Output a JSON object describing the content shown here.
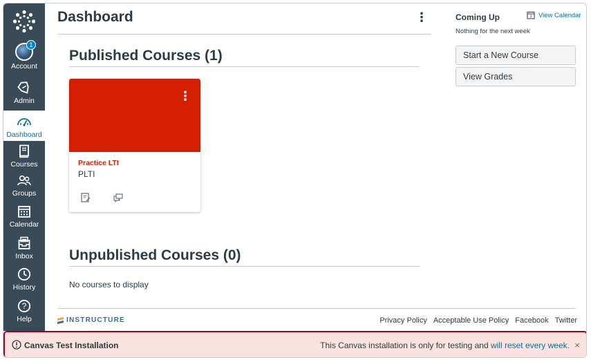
{
  "sidebar": {
    "logo_icon": "canvas-logo-icon",
    "items": [
      {
        "label": "Account",
        "icon": "avatar",
        "badge": "1"
      },
      {
        "label": "Admin",
        "icon": "shield-icon"
      },
      {
        "label": "Dashboard",
        "icon": "dashboard-gauge-icon",
        "active": true
      },
      {
        "label": "Courses",
        "icon": "book-icon"
      },
      {
        "label": "Groups",
        "icon": "groups-icon"
      },
      {
        "label": "Calendar",
        "icon": "calendar-icon"
      },
      {
        "label": "Inbox",
        "icon": "inbox-icon"
      },
      {
        "label": "History",
        "icon": "clock-icon"
      },
      {
        "label": "Help",
        "icon": "help-icon"
      }
    ]
  },
  "header": {
    "title": "Dashboard",
    "options_icon": "kebab-icon"
  },
  "published": {
    "heading": "Published Courses (1)",
    "courses": [
      {
        "name": "Practice LTI",
        "code": "PLTI",
        "color": "#d41e00"
      }
    ]
  },
  "unpublished": {
    "heading": "Unpublished Courses (0)",
    "empty_text": "No courses to display"
  },
  "footer": {
    "brand": "INSTRUCTURE",
    "links": [
      "Privacy Policy",
      "Acceptable Use Policy",
      "Facebook",
      "Twitter"
    ]
  },
  "right": {
    "coming_up": "Coming Up",
    "view_calendar": "View Calendar",
    "nothing": "Nothing for the next week",
    "buttons": [
      "Start a New Course",
      "View Grades"
    ]
  },
  "alert": {
    "title": "Canvas Test Installation",
    "message": "This Canvas installation is only for testing and ",
    "link": "will reset every week.",
    "close": "×"
  },
  "colors": {
    "sidebar": "#394b58",
    "accent": "#0770a3",
    "course": "#d41e00",
    "alert_border": "#a3001d",
    "alert_bg": "#f9e2e0"
  }
}
